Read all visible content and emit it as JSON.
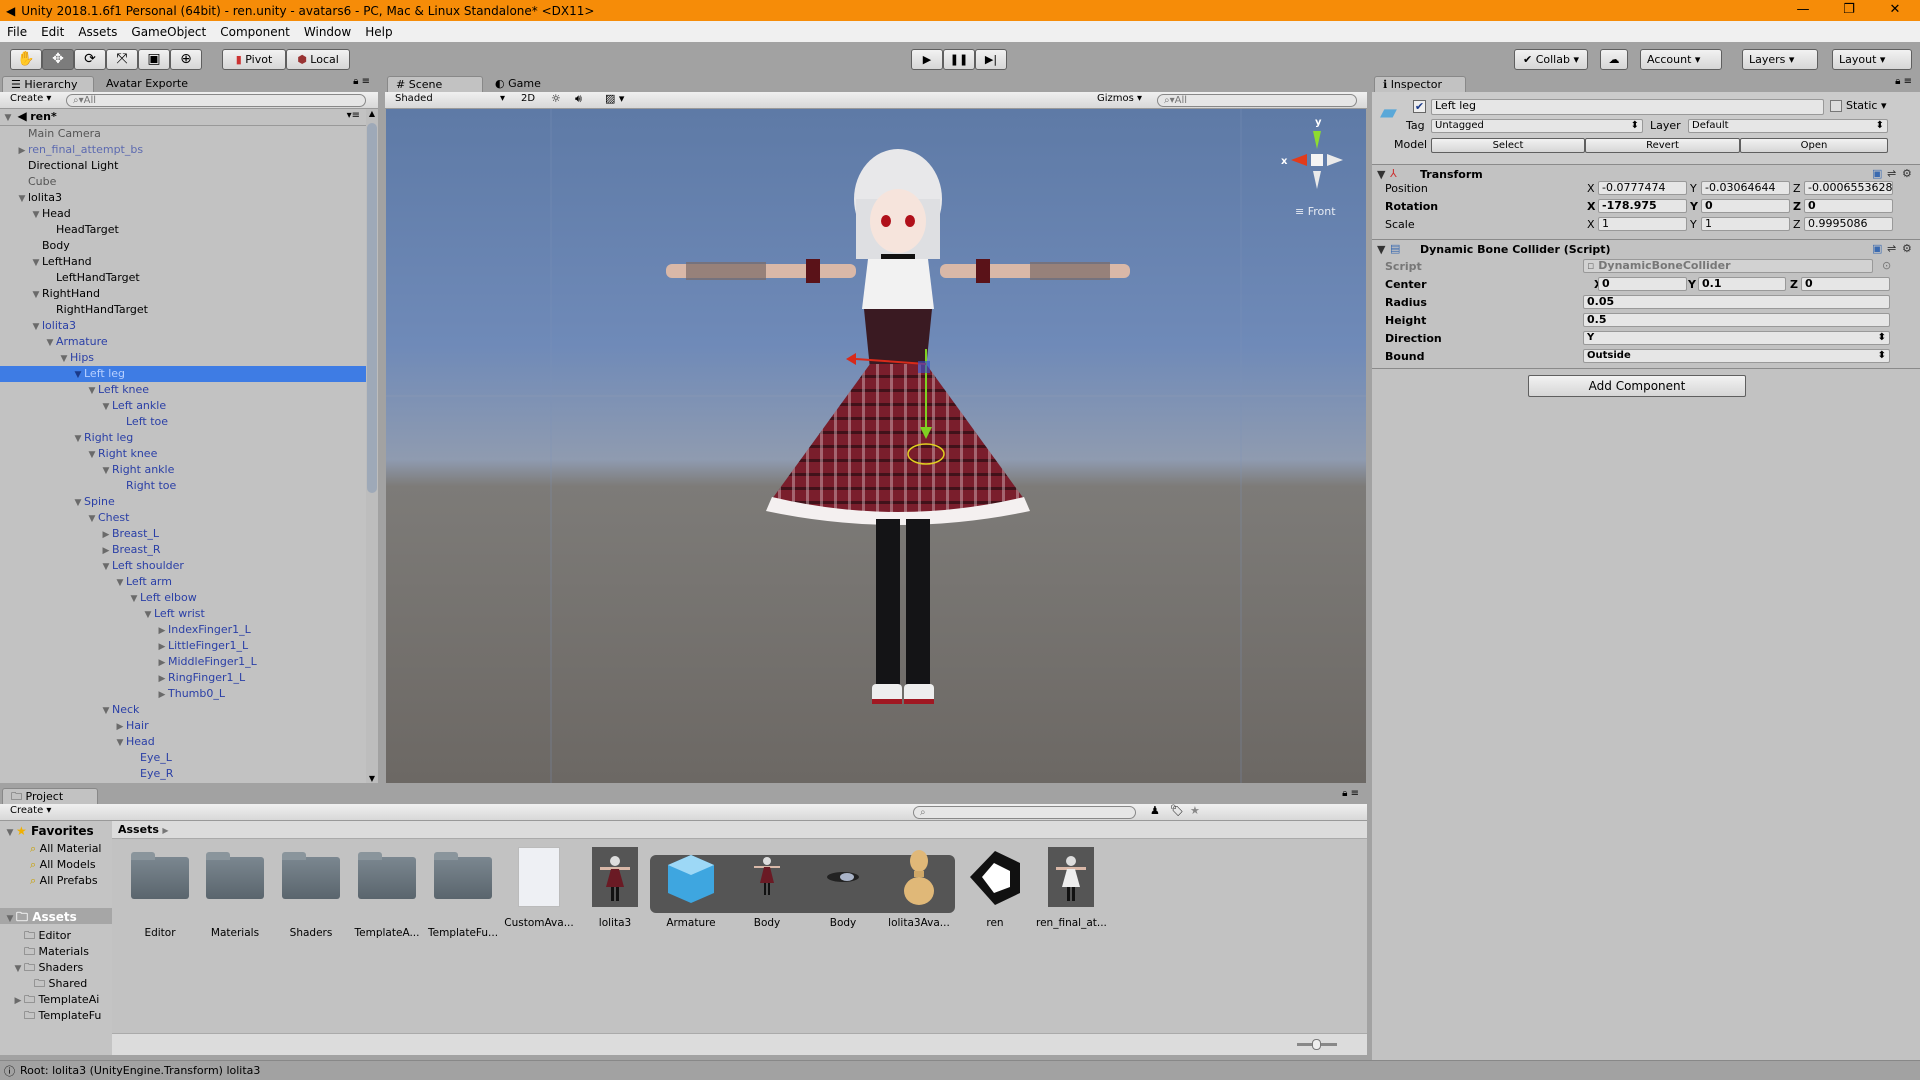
{
  "window": {
    "title": "Unity 2018.1.6f1 Personal (64bit) - ren.unity - avatars6 - PC, Mac & Linux Standalone* <DX11>",
    "minimize": "—",
    "maximize": "❐",
    "close": "✕"
  },
  "menu": [
    "File",
    "Edit",
    "Assets",
    "GameObject",
    "Component",
    "Window",
    "Help"
  ],
  "toolbar": {
    "pivot": "Pivot",
    "local": "Local",
    "collab": "Collab",
    "account": "Account",
    "layers": "Layers",
    "layout": "Layout"
  },
  "hierarchy": {
    "tabs": [
      "Hierarchy",
      "Avatar Exporte"
    ],
    "create": "Create",
    "search_placeholder": "All",
    "scene": "ren*",
    "items": [
      {
        "label": "Main Camera",
        "depth": 0,
        "arrow": "none",
        "color": "grey"
      },
      {
        "label": "ren_final_attempt_bs",
        "depth": 0,
        "arrow": "collapsed",
        "color": "prefablight"
      },
      {
        "label": "Directional Light",
        "depth": 0,
        "arrow": "none",
        "color": "black"
      },
      {
        "label": "Cube",
        "depth": 0,
        "arrow": "none",
        "color": "grey"
      },
      {
        "label": "lolita3",
        "depth": 0,
        "arrow": "expanded",
        "color": "black"
      },
      {
        "label": "Head",
        "depth": 1,
        "arrow": "expanded",
        "color": "black"
      },
      {
        "label": "HeadTarget",
        "depth": 2,
        "arrow": "none",
        "color": "black"
      },
      {
        "label": "Body",
        "depth": 1,
        "arrow": "none",
        "color": "black"
      },
      {
        "label": "LeftHand",
        "depth": 1,
        "arrow": "expanded",
        "color": "black"
      },
      {
        "label": "LeftHandTarget",
        "depth": 2,
        "arrow": "none",
        "color": "black"
      },
      {
        "label": "RightHand",
        "depth": 1,
        "arrow": "expanded",
        "color": "black"
      },
      {
        "label": "RightHandTarget",
        "depth": 2,
        "arrow": "none",
        "color": "black"
      },
      {
        "label": "lolita3",
        "depth": 1,
        "arrow": "expanded",
        "color": "prefab"
      },
      {
        "label": "Armature",
        "depth": 2,
        "arrow": "expanded",
        "color": "prefab"
      },
      {
        "label": "Hips",
        "depth": 3,
        "arrow": "expanded",
        "color": "prefab"
      },
      {
        "label": "Left leg",
        "depth": 4,
        "arrow": "expanded",
        "color": "prefab",
        "selected": true
      },
      {
        "label": "Left knee",
        "depth": 5,
        "arrow": "expanded",
        "color": "prefab"
      },
      {
        "label": "Left ankle",
        "depth": 6,
        "arrow": "expanded",
        "color": "prefab"
      },
      {
        "label": "Left toe",
        "depth": 7,
        "arrow": "none",
        "color": "prefab"
      },
      {
        "label": "Right leg",
        "depth": 4,
        "arrow": "expanded",
        "color": "prefab"
      },
      {
        "label": "Right knee",
        "depth": 5,
        "arrow": "expanded",
        "color": "prefab"
      },
      {
        "label": "Right ankle",
        "depth": 6,
        "arrow": "expanded",
        "color": "prefab"
      },
      {
        "label": "Right toe",
        "depth": 7,
        "arrow": "none",
        "color": "prefab"
      },
      {
        "label": "Spine",
        "depth": 4,
        "arrow": "expanded",
        "color": "prefab"
      },
      {
        "label": "Chest",
        "depth": 5,
        "arrow": "expanded",
        "color": "prefab"
      },
      {
        "label": "Breast_L",
        "depth": 6,
        "arrow": "collapsed",
        "color": "prefab"
      },
      {
        "label": "Breast_R",
        "depth": 6,
        "arrow": "collapsed",
        "color": "prefab"
      },
      {
        "label": "Left shoulder",
        "depth": 6,
        "arrow": "expanded",
        "color": "prefab"
      },
      {
        "label": "Left arm",
        "depth": 7,
        "arrow": "expanded",
        "color": "prefab"
      },
      {
        "label": "Left elbow",
        "depth": 8,
        "arrow": "expanded",
        "color": "prefab"
      },
      {
        "label": "Left wrist",
        "depth": 9,
        "arrow": "expanded",
        "color": "prefab"
      },
      {
        "label": "IndexFinger1_L",
        "depth": 10,
        "arrow": "collapsed",
        "color": "prefab"
      },
      {
        "label": "LittleFinger1_L",
        "depth": 10,
        "arrow": "collapsed",
        "color": "prefab"
      },
      {
        "label": "MiddleFinger1_L",
        "depth": 10,
        "arrow": "collapsed",
        "color": "prefab"
      },
      {
        "label": "RingFinger1_L",
        "depth": 10,
        "arrow": "collapsed",
        "color": "prefab"
      },
      {
        "label": "Thumb0_L",
        "depth": 10,
        "arrow": "collapsed",
        "color": "prefab"
      },
      {
        "label": "Neck",
        "depth": 6,
        "arrow": "expanded",
        "color": "prefab"
      },
      {
        "label": "Hair",
        "depth": 7,
        "arrow": "collapsed",
        "color": "prefab"
      },
      {
        "label": "Head",
        "depth": 7,
        "arrow": "expanded",
        "color": "prefab"
      },
      {
        "label": "Eye_L",
        "depth": 8,
        "arrow": "none",
        "color": "prefab"
      },
      {
        "label": "Eye_R",
        "depth": 8,
        "arrow": "none",
        "color": "prefab"
      }
    ]
  },
  "scene": {
    "tabs": [
      "Scene",
      "Game"
    ],
    "shading": "Shaded",
    "mode_2d": "2D",
    "gizmos": "Gizmos",
    "search_placeholder": "All",
    "gizmo_x": "x",
    "gizmo_y": "y",
    "view_label": "Front"
  },
  "inspector": {
    "tab": "Inspector",
    "name": "Left leg",
    "active": true,
    "static_label": "Static",
    "tag_label": "Tag",
    "tag": "Untagged",
    "layer_label": "Layer",
    "layer": "Default",
    "model_label": "Model",
    "model_buttons": [
      "Select",
      "Revert",
      "Open"
    ],
    "transform": {
      "title": "Transform",
      "position": {
        "label": "Position",
        "x": "-0.0777474",
        "y": "-0.03064644",
        "z": "-0.0006553628"
      },
      "rotation": {
        "label": "Rotation",
        "x": "-178.975",
        "y": "0",
        "z": "0"
      },
      "scale": {
        "label": "Scale",
        "x": "1",
        "y": "1",
        "z": "0.9995086"
      }
    },
    "collider": {
      "title": "Dynamic Bone Collider (Script)",
      "script_label": "Script",
      "script": "DynamicBoneCollider",
      "center": {
        "label": "Center",
        "x": "0",
        "y": "0.1",
        "z": "0"
      },
      "radius_label": "Radius",
      "radius": "0.05",
      "height_label": "Height",
      "height": "0.5",
      "direction_label": "Direction",
      "direction": "Y",
      "bound_label": "Bound",
      "bound": "Outside"
    },
    "add_component": "Add Component",
    "axes": [
      "X",
      "Y",
      "Z"
    ]
  },
  "project": {
    "tab": "Project",
    "create": "Create",
    "favorites": {
      "title": "Favorites",
      "items": [
        "All Material",
        "All Models",
        "All Prefabs"
      ]
    },
    "assets_tree": {
      "title": "Assets",
      "items": [
        {
          "label": "Editor",
          "depth": 1,
          "arrow": "none"
        },
        {
          "label": "Materials",
          "depth": 1,
          "arrow": "none"
        },
        {
          "label": "Shaders",
          "depth": 1,
          "arrow": "expanded"
        },
        {
          "label": "Shared",
          "depth": 2,
          "arrow": "none"
        },
        {
          "label": "TemplateAі",
          "depth": 1,
          "arrow": "collapsed"
        },
        {
          "label": "TemplateFu",
          "depth": 1,
          "arrow": "none"
        }
      ]
    },
    "breadcrumb": "Assets",
    "assets": [
      {
        "label": "Editor",
        "kind": "folder"
      },
      {
        "label": "Materials",
        "kind": "folder"
      },
      {
        "label": "Shaders",
        "kind": "folder"
      },
      {
        "label": "TemplateA...",
        "kind": "folder"
      },
      {
        "label": "TemplateFu...",
        "kind": "folder"
      },
      {
        "label": "CustomAva...",
        "kind": "file"
      },
      {
        "label": "lolita3",
        "kind": "model"
      },
      {
        "label": "Armature",
        "kind": "cube"
      },
      {
        "label": "Body",
        "kind": "figure"
      },
      {
        "label": "Body",
        "kind": "mesh"
      },
      {
        "label": "lolita3Ava...",
        "kind": "avatar"
      },
      {
        "label": "ren",
        "kind": "unity"
      },
      {
        "label": "ren_final_at...",
        "kind": "model2"
      }
    ]
  },
  "status": "Root: lolita3 (UnityEngine.Transform) lolita3",
  "colors": {
    "titlebar": "#f68c08",
    "selection": "#3e7ce4",
    "prefab_text": "#2a3fa6",
    "panel": "#c2c2c2"
  }
}
